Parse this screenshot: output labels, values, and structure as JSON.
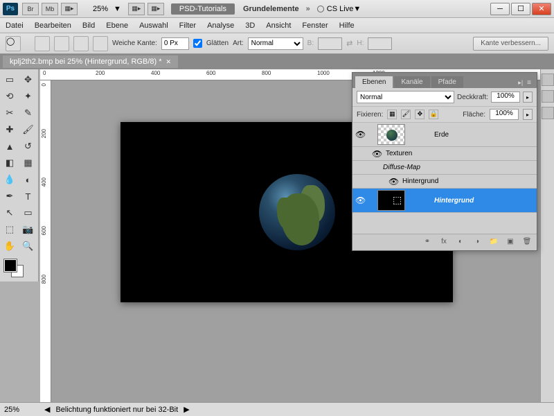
{
  "titlebar": {
    "ps": "Ps",
    "br": "Br",
    "mb": "Mb",
    "zoom": "25%",
    "center_badge": "PSD-Tutorials",
    "workspace_name": "Grundelemente",
    "cslive": "CS Live"
  },
  "menu": [
    "Datei",
    "Bearbeiten",
    "Bild",
    "Ebene",
    "Auswahl",
    "Filter",
    "Analyse",
    "3D",
    "Ansicht",
    "Fenster",
    "Hilfe"
  ],
  "options": {
    "weiche_kante_label": "Weiche Kante:",
    "weiche_kante_value": "0 Px",
    "glatten": "Glätten",
    "art_label": "Art:",
    "art_value": "Normal",
    "b_label": "B:",
    "h_label": "H:",
    "refine": "Kante verbessern..."
  },
  "doc_tab": "kplj2th2.bmp bei 25% (Hintergrund, RGB/8) *",
  "ruler_h": [
    "0",
    "200",
    "400",
    "600",
    "800",
    "1000",
    "1200"
  ],
  "ruler_v": [
    "0",
    "200",
    "400",
    "600",
    "800"
  ],
  "panel": {
    "tabs": [
      "Ebenen",
      "Kanäle",
      "Pfade"
    ],
    "blend_mode": "Normal",
    "deckkraft_label": "Deckkraft:",
    "deckkraft_value": "100%",
    "fix_label": "Fixieren:",
    "flache_label": "Fläche:",
    "flache_value": "100%",
    "layers": [
      {
        "name": "Erde"
      },
      {
        "name": "Texturen"
      },
      {
        "name": "Diffuse-Map",
        "italic": true
      },
      {
        "name": "Hintergrund",
        "sub": true
      },
      {
        "name": "Hintergrund",
        "selected": true,
        "bold": true
      }
    ]
  },
  "status": {
    "zoom": "25%",
    "msg": "Belichtung funktioniert nur bei 32-Bit"
  }
}
